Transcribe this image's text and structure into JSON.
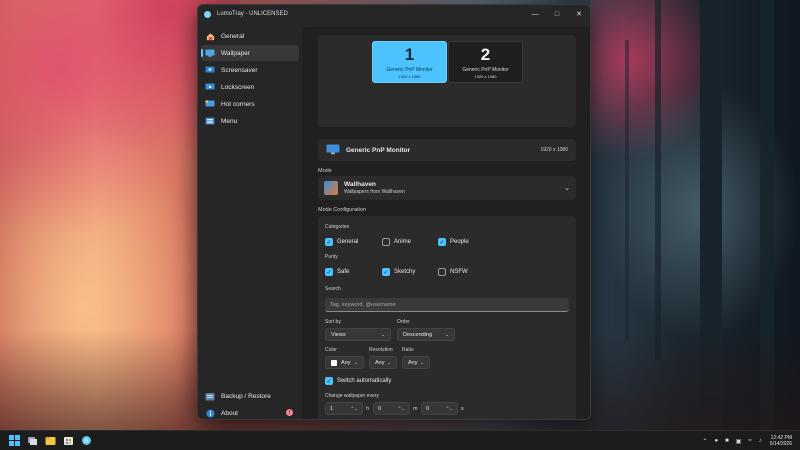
{
  "window": {
    "title": "LumoTray - UNLICENSED"
  },
  "sidebar": {
    "items": [
      {
        "label": "General",
        "icon": "home-icon",
        "active": false
      },
      {
        "label": "Wallpaper",
        "icon": "wallpaper-icon",
        "active": true
      },
      {
        "label": "Screensaver",
        "icon": "screensaver-icon",
        "active": false
      },
      {
        "label": "Lockscreen",
        "icon": "lockscreen-icon",
        "active": false
      },
      {
        "label": "Hot corners",
        "icon": "hot-corners-icon",
        "active": false
      },
      {
        "label": "Menu",
        "icon": "menu-icon",
        "active": false
      }
    ],
    "bottom": [
      {
        "label": "Backup / Restore",
        "icon": "backup-icon"
      },
      {
        "label": "About",
        "icon": "info-icon",
        "badge": "!"
      }
    ]
  },
  "monitors": [
    {
      "number": "1",
      "name": "Generic PnP Monitor",
      "resolution": "1920 x 1080",
      "selected": true
    },
    {
      "number": "2",
      "name": "Generic PnP Monitor",
      "resolution": "1920 x 1080",
      "selected": false
    }
  ],
  "selected_monitor": {
    "name": "Generic PnP Monitor",
    "resolution": "1920 x 1080"
  },
  "mode": {
    "label": "Mode",
    "title": "Wallhaven",
    "subtitle": "Wallpapers from Wallhaven"
  },
  "config": {
    "label": "Mode Configuration",
    "categories_label": "Categories",
    "categories": [
      {
        "label": "General",
        "checked": true
      },
      {
        "label": "Anime",
        "checked": false
      },
      {
        "label": "People",
        "checked": true
      }
    ],
    "purity_label": "Purity",
    "purity": [
      {
        "label": "Safe",
        "checked": true
      },
      {
        "label": "Sketchy",
        "checked": true
      },
      {
        "label": "NSFW",
        "checked": false
      }
    ],
    "search_label": "Search",
    "search_placeholder": "Tag, keyword, @username",
    "sort_label": "Sort by",
    "sort_value": "Views",
    "order_label": "Order",
    "order_value": "Descending",
    "color_label": "Color",
    "color_value": "Any",
    "resolution_label": "Resolution",
    "resolution_value": "Any",
    "ratio_label": "Ratio",
    "ratio_value": "Any",
    "switch_label": "Switch automatically",
    "switch_checked": true,
    "interval_label": "Change wallpaper every",
    "hours": "1",
    "hours_unit": "h",
    "minutes": "0",
    "minutes_unit": "m",
    "seconds": "0",
    "seconds_unit": "s"
  },
  "taskbar": {
    "time": "12:42 PM",
    "date": "5/14/2026"
  },
  "colors": {
    "accent": "#4cc2ff",
    "window_bg": "#262626",
    "content_bg": "#202020",
    "card_bg": "#2b2b2b"
  }
}
